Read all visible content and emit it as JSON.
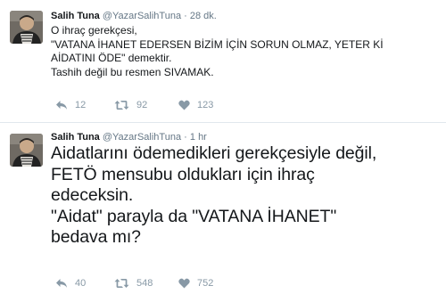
{
  "tweets": [
    {
      "author": {
        "name": "Salih Tuna",
        "handle": "@YazarSalihTuna"
      },
      "separator": "·",
      "time": "28 dk.",
      "lines": [
        "O ihraç gerekçesi,",
        "\"VATANA İHANET EDERSEN BİZİM İÇİN SORUN OLMAZ, YETER Kİ",
        "AİDATINI ÖDE\" demektir.",
        "Tashih değil bu resmen SIVAMAK."
      ],
      "actions": {
        "replies": "12",
        "retweets": "92",
        "likes": "123"
      }
    },
    {
      "author": {
        "name": "Salih Tuna",
        "handle": "@YazarSalihTuna"
      },
      "separator": "·",
      "time": "1 hr",
      "lines": [
        "Aidatlarını ödemedikleri gerekçesiyle değil,",
        "FETÖ mensubu oldukları için ihraç",
        "edeceksin.",
        "\"Aidat\" parayla da \"VATANA İHANET\"",
        "bedava mı?"
      ],
      "actions": {
        "replies": "40",
        "retweets": "548",
        "likes": "752"
      }
    }
  ],
  "icons": {
    "reply": "reply-icon",
    "retweet": "retweet-icon",
    "like": "heart-icon"
  },
  "colors": {
    "text": "#14171a",
    "meta": "#657786",
    "action": "#8899a6",
    "divider": "#e1e8ed"
  }
}
